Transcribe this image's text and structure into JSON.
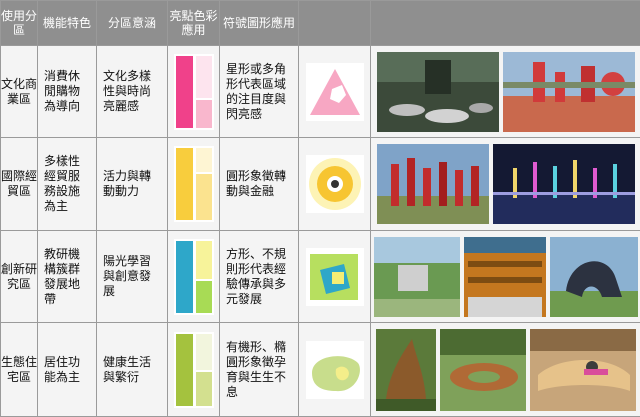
{
  "header": {
    "col1": "使用分區",
    "col2": "機能特色",
    "col3": "分區意涵",
    "col4": "亮點色彩應用",
    "col5": "符號圖形應用",
    "col6": "",
    "col7": ""
  },
  "rows": [
    {
      "zone": "文化商業區",
      "feature": "消費休閒購物為導向",
      "meaning": "文化多樣性與時尚亮麗感",
      "symbol_desc": "星形或多角形代表區域的注目度與閃亮感",
      "colors": {
        "main": "#f0418a",
        "light": "#f9b7cd"
      }
    },
    {
      "zone": "國際經貿區",
      "feature": "多樣性經貿服務設施為主",
      "meaning": "活力與轉動動力",
      "symbol_desc": "圓形象徵轉動與金融",
      "colors": {
        "main": "#f8cd3d",
        "light": "#fbe38f"
      }
    },
    {
      "zone": "創新研究區",
      "feature": "教研機構簇群發展地帶",
      "meaning": "陽光學習與創意發展",
      "symbol_desc": "方形、不規則形代表經驗傳承與多元發展",
      "colors": {
        "main": "#2ea7c9",
        "light": "#a8db55"
      }
    },
    {
      "zone": "生態住宅區",
      "feature": "居住功能為主",
      "meaning": "健康生活與繁衍",
      "symbol_desc": "有機形、橢圓形象徵孕育與生生不息",
      "colors": {
        "main": "#a4c23e",
        "light": "#d3e08f"
      }
    }
  ]
}
